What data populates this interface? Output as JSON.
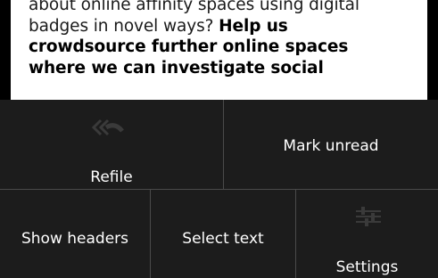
{
  "message": {
    "line1": "about online affinity spaces using digital",
    "line2_plain": "badges in novel ways? ",
    "line2_bold": "Help us",
    "line3_bold": "crowdsource further online spaces",
    "line4_bold": "where we can investigate social"
  },
  "menu": {
    "items": [
      {
        "label": "Refile",
        "icon": "refile-icon"
      },
      {
        "label": "Mark unread"
      },
      {
        "label": "Show headers"
      },
      {
        "label": "Select text"
      },
      {
        "label": "Settings",
        "icon": "settings-icon"
      }
    ]
  }
}
